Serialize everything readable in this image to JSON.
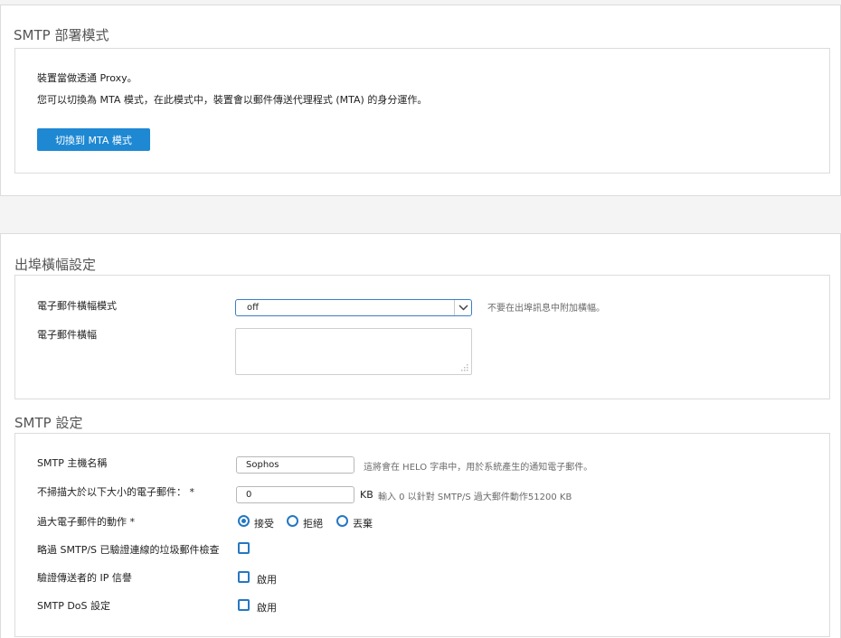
{
  "smtp_mode": {
    "title": "SMTP 部署模式",
    "line1": "裝置當做透通 Proxy。",
    "line2": "您可以切換為 MTA 模式，在此模式中，裝置會以郵件傳送代理程式 (MTA) 的身分運作。",
    "switch_button": "切換到 MTA 模式"
  },
  "outbound_banner": {
    "title": "出埠橫幅設定",
    "mode_label": "電子郵件橫幅模式",
    "mode_value": "off",
    "mode_hint": "不要在出埠訊息中附加橫幅。",
    "banner_label": "電子郵件橫幅",
    "banner_value": ""
  },
  "smtp_settings": {
    "title": "SMTP 設定",
    "hostname_label": "SMTP 主機名稱",
    "hostname_value": "Sophos",
    "hostname_hint": "這將會在 HELO 字串中，用於系統產生的通知電子郵件。",
    "noscan_label": "不掃描大於以下大小的電子郵件： *",
    "noscan_value": "0",
    "noscan_unit": "KB",
    "noscan_hint": "輸入 0 以針對 SMTP/S 過大郵件動作51200 KB",
    "oversize_label": "過大電子郵件的動作 *",
    "oversize_options": [
      "接受",
      "拒絕",
      "丟棄"
    ],
    "oversize_selected": "接受",
    "skip_spam_label": "略過 SMTP/S 已驗證連線的垃圾郵件檢查",
    "ip_rep_label": "驗證傳送者的 IP 信譽",
    "ip_rep_option": "啟用",
    "dos_label": "SMTP DoS 設定",
    "dos_option": "啟用"
  },
  "colors": {
    "accent": "#1e88d3",
    "control_blue": "#2478c2",
    "border": "#dcdcdc",
    "background": "#f4f4f4"
  }
}
